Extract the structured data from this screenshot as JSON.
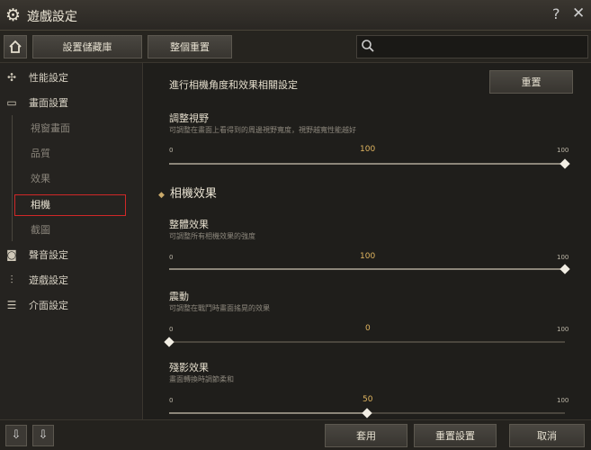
{
  "window": {
    "title": "遊戲設定",
    "help": "?",
    "close": "✕"
  },
  "toolbar": {
    "buttons": [
      "設置儲藏庫",
      "整個重置"
    ]
  },
  "sidebar": {
    "items": [
      {
        "label": "性能設定"
      },
      {
        "label": "畫面設置"
      },
      {
        "label": "視窗畫面"
      },
      {
        "label": "品質"
      },
      {
        "label": "效果"
      },
      {
        "label": "相機"
      },
      {
        "label": "截圖"
      },
      {
        "label": "聲音設定"
      },
      {
        "label": "遊戲設定"
      },
      {
        "label": "介面設定"
      }
    ]
  },
  "content": {
    "header": "進行相機角度和效果相關設定",
    "reset_button": "重置",
    "fov": {
      "title": "調整視野",
      "desc": "可調整在畫面上看得到的周邊視野寬度，視野越寬性能越好",
      "min": "0",
      "max": "100",
      "value": "100",
      "level": 1.0
    },
    "section_title": "相機效果",
    "overall": {
      "title": "整體效果",
      "desc": "可調整所有相機效果的強度",
      "min": "0",
      "max": "100",
      "value": "100",
      "level": 1.0
    },
    "shake": {
      "title": "震動",
      "desc": "可調整在戰鬥時畫面搖晃的效果",
      "min": "0",
      "max": "100",
      "value": "0",
      "level": 0.0
    },
    "afterimage": {
      "title": "殘影效果",
      "desc": "畫面轉換時調節柔和",
      "min": "0",
      "max": "100",
      "value": "50",
      "level": 0.5
    }
  },
  "bottom": {
    "apply": "套用",
    "reset": "重置設置",
    "cancel": "取消"
  }
}
